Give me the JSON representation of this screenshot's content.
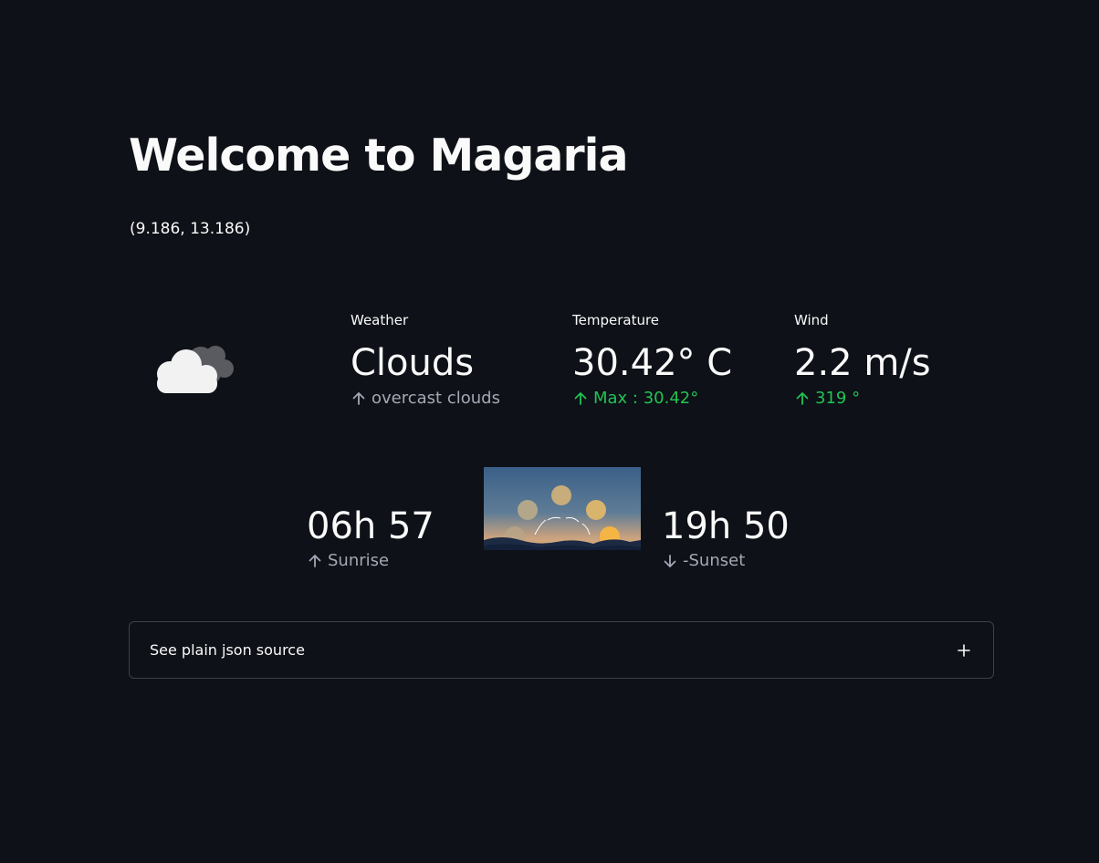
{
  "page": {
    "title": "Welcome to Magaria",
    "coordinates": "(9.186, 13.186)"
  },
  "weather_icon": {
    "icon": "cloud-icon"
  },
  "metrics": [
    {
      "label": "Weather",
      "value": "Clouds",
      "delta": "overcast clouds",
      "delta_direction": "up",
      "delta_color": "#a3a8b4"
    },
    {
      "label": "Temperature",
      "value": "30.42° C",
      "delta": "Max : 30.42°",
      "delta_direction": "up",
      "delta_color": "#21c354"
    },
    {
      "label": "Wind",
      "value": "2.2 m/s",
      "delta": "319 °",
      "delta_direction": "up",
      "delta_color": "#21c354"
    }
  ],
  "sunrise": {
    "value": "06h 57",
    "label": "Sunrise",
    "direction": "up"
  },
  "sunset": {
    "value": "19h 50",
    "label": "-Sunset",
    "direction": "down"
  },
  "sun_image": {
    "icon": "sun-path-image"
  },
  "expander": {
    "label": "See plain json source",
    "icon": "plus-icon"
  },
  "colors": {
    "background": "#0e1117",
    "text": "#fafafa",
    "muted": "#a3a8b4",
    "positive": "#21c354",
    "border": "#3d4149"
  }
}
